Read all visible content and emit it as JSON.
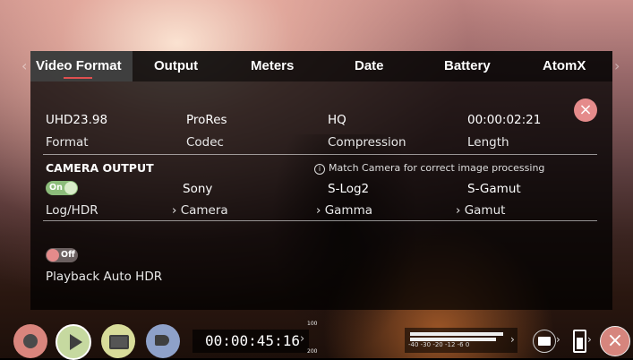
{
  "tabs": [
    {
      "label": "Video Format",
      "active": true
    },
    {
      "label": "Output",
      "active": false
    },
    {
      "label": "Meters",
      "active": false
    },
    {
      "label": "Date",
      "active": false
    },
    {
      "label": "Battery",
      "active": false
    },
    {
      "label": "AtomX",
      "active": false
    }
  ],
  "nav": {
    "left_arrow": "‹",
    "right_arrow": "›"
  },
  "format_row": [
    {
      "value": "UHD23.98",
      "label": "Format"
    },
    {
      "value": "ProRes",
      "label": "Codec"
    },
    {
      "value": "HQ",
      "label": "Compression"
    },
    {
      "value": "00:00:02:21",
      "label": "Length"
    }
  ],
  "camera_output": {
    "title": "CAMERA OUTPUT",
    "hint": "Match Camera for correct image processing",
    "toggle_label": "On",
    "toggle_state": true,
    "items": [
      {
        "value": "",
        "label": "Log/HDR"
      },
      {
        "value": "Sony",
        "label": "Camera",
        "prefix": "›"
      },
      {
        "value": "S-Log2",
        "label": "Gamma",
        "prefix": "›"
      },
      {
        "value": "S-Gamut",
        "label": "Gamut",
        "prefix": "›"
      }
    ]
  },
  "playback": {
    "toggle_label": "Off",
    "toggle_state": false,
    "label": "Playback Auto HDR"
  },
  "close_symbol": "×",
  "bottom_bar": {
    "timecode": "00:00:45:16",
    "timecode_arrow": "›",
    "meter_top_label": "100",
    "meter_bottom_label": "200",
    "audio_scale": "-40   -30   -20  -12   -6   0",
    "audio_arrow": "›",
    "folder_arrow": "›",
    "battery_arrow": "›",
    "close_symbol": "×"
  },
  "colors": {
    "accent_red": "#e05050",
    "close_pink": "#e58b8b",
    "toggle_on": "#8cbc7a",
    "record_button": "#d9857d",
    "play_button": "#c6d9a0",
    "monitor_button": "#d8dc9a",
    "tag_button": "#8ea1c9"
  },
  "icons": [
    "record-icon",
    "play-icon",
    "monitor-icon",
    "tag-icon",
    "folder-icon",
    "battery-icon",
    "info-icon",
    "close-icon"
  ]
}
